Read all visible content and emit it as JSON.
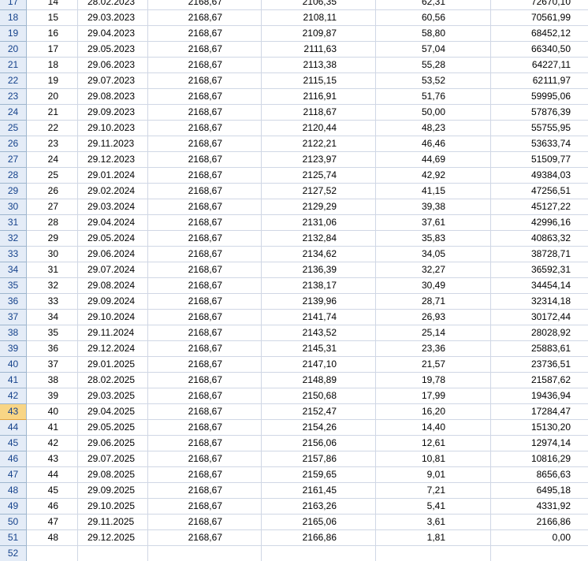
{
  "sheet": {
    "active_row": "43",
    "rows": [
      {
        "h": "17",
        "n": "14",
        "date": "28.02.2023",
        "payment": "2168,67",
        "principal": "2106,35",
        "interest": "62,31",
        "balance": "72670,10"
      },
      {
        "h": "18",
        "n": "15",
        "date": "29.03.2023",
        "payment": "2168,67",
        "principal": "2108,11",
        "interest": "60,56",
        "balance": "70561,99"
      },
      {
        "h": "19",
        "n": "16",
        "date": "29.04.2023",
        "payment": "2168,67",
        "principal": "2109,87",
        "interest": "58,80",
        "balance": "68452,12"
      },
      {
        "h": "20",
        "n": "17",
        "date": "29.05.2023",
        "payment": "2168,67",
        "principal": "2111,63",
        "interest": "57,04",
        "balance": "66340,50"
      },
      {
        "h": "21",
        "n": "18",
        "date": "29.06.2023",
        "payment": "2168,67",
        "principal": "2113,38",
        "interest": "55,28",
        "balance": "64227,11"
      },
      {
        "h": "22",
        "n": "19",
        "date": "29.07.2023",
        "payment": "2168,67",
        "principal": "2115,15",
        "interest": "53,52",
        "balance": "62111,97"
      },
      {
        "h": "23",
        "n": "20",
        "date": "29.08.2023",
        "payment": "2168,67",
        "principal": "2116,91",
        "interest": "51,76",
        "balance": "59995,06"
      },
      {
        "h": "24",
        "n": "21",
        "date": "29.09.2023",
        "payment": "2168,67",
        "principal": "2118,67",
        "interest": "50,00",
        "balance": "57876,39"
      },
      {
        "h": "25",
        "n": "22",
        "date": "29.10.2023",
        "payment": "2168,67",
        "principal": "2120,44",
        "interest": "48,23",
        "balance": "55755,95"
      },
      {
        "h": "26",
        "n": "23",
        "date": "29.11.2023",
        "payment": "2168,67",
        "principal": "2122,21",
        "interest": "46,46",
        "balance": "53633,74"
      },
      {
        "h": "27",
        "n": "24",
        "date": "29.12.2023",
        "payment": "2168,67",
        "principal": "2123,97",
        "interest": "44,69",
        "balance": "51509,77"
      },
      {
        "h": "28",
        "n": "25",
        "date": "29.01.2024",
        "payment": "2168,67",
        "principal": "2125,74",
        "interest": "42,92",
        "balance": "49384,03"
      },
      {
        "h": "29",
        "n": "26",
        "date": "29.02.2024",
        "payment": "2168,67",
        "principal": "2127,52",
        "interest": "41,15",
        "balance": "47256,51"
      },
      {
        "h": "30",
        "n": "27",
        "date": "29.03.2024",
        "payment": "2168,67",
        "principal": "2129,29",
        "interest": "39,38",
        "balance": "45127,22"
      },
      {
        "h": "31",
        "n": "28",
        "date": "29.04.2024",
        "payment": "2168,67",
        "principal": "2131,06",
        "interest": "37,61",
        "balance": "42996,16"
      },
      {
        "h": "32",
        "n": "29",
        "date": "29.05.2024",
        "payment": "2168,67",
        "principal": "2132,84",
        "interest": "35,83",
        "balance": "40863,32"
      },
      {
        "h": "33",
        "n": "30",
        "date": "29.06.2024",
        "payment": "2168,67",
        "principal": "2134,62",
        "interest": "34,05",
        "balance": "38728,71"
      },
      {
        "h": "34",
        "n": "31",
        "date": "29.07.2024",
        "payment": "2168,67",
        "principal": "2136,39",
        "interest": "32,27",
        "balance": "36592,31"
      },
      {
        "h": "35",
        "n": "32",
        "date": "29.08.2024",
        "payment": "2168,67",
        "principal": "2138,17",
        "interest": "30,49",
        "balance": "34454,14"
      },
      {
        "h": "36",
        "n": "33",
        "date": "29.09.2024",
        "payment": "2168,67",
        "principal": "2139,96",
        "interest": "28,71",
        "balance": "32314,18"
      },
      {
        "h": "37",
        "n": "34",
        "date": "29.10.2024",
        "payment": "2168,67",
        "principal": "2141,74",
        "interest": "26,93",
        "balance": "30172,44"
      },
      {
        "h": "38",
        "n": "35",
        "date": "29.11.2024",
        "payment": "2168,67",
        "principal": "2143,52",
        "interest": "25,14",
        "balance": "28028,92"
      },
      {
        "h": "39",
        "n": "36",
        "date": "29.12.2024",
        "payment": "2168,67",
        "principal": "2145,31",
        "interest": "23,36",
        "balance": "25883,61"
      },
      {
        "h": "40",
        "n": "37",
        "date": "29.01.2025",
        "payment": "2168,67",
        "principal": "2147,10",
        "interest": "21,57",
        "balance": "23736,51"
      },
      {
        "h": "41",
        "n": "38",
        "date": "28.02.2025",
        "payment": "2168,67",
        "principal": "2148,89",
        "interest": "19,78",
        "balance": "21587,62"
      },
      {
        "h": "42",
        "n": "39",
        "date": "29.03.2025",
        "payment": "2168,67",
        "principal": "2150,68",
        "interest": "17,99",
        "balance": "19436,94"
      },
      {
        "h": "43",
        "n": "40",
        "date": "29.04.2025",
        "payment": "2168,67",
        "principal": "2152,47",
        "interest": "16,20",
        "balance": "17284,47"
      },
      {
        "h": "44",
        "n": "41",
        "date": "29.05.2025",
        "payment": "2168,67",
        "principal": "2154,26",
        "interest": "14,40",
        "balance": "15130,20"
      },
      {
        "h": "45",
        "n": "42",
        "date": "29.06.2025",
        "payment": "2168,67",
        "principal": "2156,06",
        "interest": "12,61",
        "balance": "12974,14"
      },
      {
        "h": "46",
        "n": "43",
        "date": "29.07.2025",
        "payment": "2168,67",
        "principal": "2157,86",
        "interest": "10,81",
        "balance": "10816,29"
      },
      {
        "h": "47",
        "n": "44",
        "date": "29.08.2025",
        "payment": "2168,67",
        "principal": "2159,65",
        "interest": "9,01",
        "balance": "8656,63"
      },
      {
        "h": "48",
        "n": "45",
        "date": "29.09.2025",
        "payment": "2168,67",
        "principal": "2161,45",
        "interest": "7,21",
        "balance": "6495,18"
      },
      {
        "h": "49",
        "n": "46",
        "date": "29.10.2025",
        "payment": "2168,67",
        "principal": "2163,26",
        "interest": "5,41",
        "balance": "4331,92"
      },
      {
        "h": "50",
        "n": "47",
        "date": "29.11.2025",
        "payment": "2168,67",
        "principal": "2165,06",
        "interest": "3,61",
        "balance": "2166,86"
      },
      {
        "h": "51",
        "n": "48",
        "date": "29.12.2025",
        "payment": "2168,67",
        "principal": "2166,86",
        "interest": "1,81",
        "balance": "0,00"
      },
      {
        "h": "52",
        "n": "",
        "date": "",
        "payment": "",
        "principal": "",
        "interest": "",
        "balance": ""
      }
    ]
  }
}
